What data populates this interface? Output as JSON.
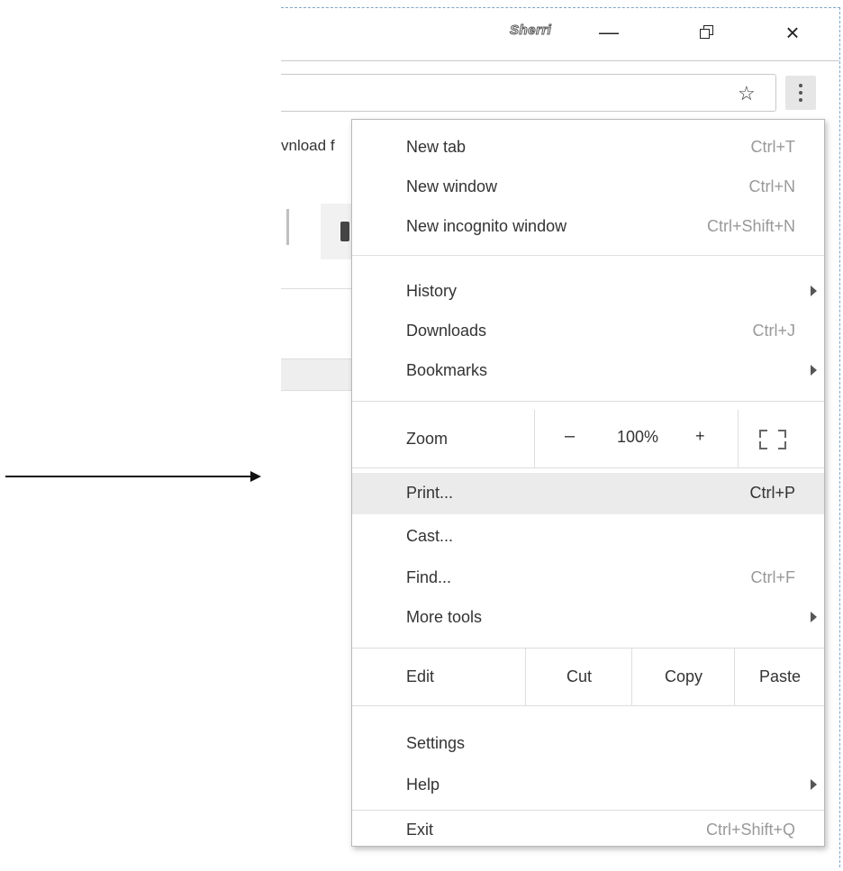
{
  "window": {
    "profile_name": "Sherri",
    "minimize_glyph": "—",
    "close_glyph": "×"
  },
  "page": {
    "bookmark_fragment": "vnload f"
  },
  "menu": {
    "group1": [
      {
        "label": "New tab",
        "shortcut": "Ctrl+T"
      },
      {
        "label": "New window",
        "shortcut": "Ctrl+N"
      },
      {
        "label": "New incognito window",
        "shortcut": "Ctrl+Shift+N"
      }
    ],
    "group2": [
      {
        "label": "History",
        "submenu": true
      },
      {
        "label": "Downloads",
        "shortcut": "Ctrl+J"
      },
      {
        "label": "Bookmarks",
        "submenu": true
      }
    ],
    "zoom": {
      "label": "Zoom",
      "minus": "–",
      "value": "100%",
      "plus": "+"
    },
    "group3": [
      {
        "label": "Print...",
        "shortcut": "Ctrl+P",
        "highlighted": true
      },
      {
        "label": "Cast..."
      },
      {
        "label": "Find...",
        "shortcut": "Ctrl+F"
      },
      {
        "label": "More tools",
        "submenu": true
      }
    ],
    "edit": {
      "label": "Edit",
      "cut": "Cut",
      "copy": "Copy",
      "paste": "Paste"
    },
    "group4": [
      {
        "label": "Settings"
      },
      {
        "label": "Help",
        "submenu": true
      }
    ],
    "exit": {
      "label": "Exit",
      "shortcut": "Ctrl+Shift+Q"
    }
  },
  "icons": {
    "star": "star-icon",
    "menu": "three-dot-menu-icon",
    "arrow": "pointer-arrow"
  }
}
